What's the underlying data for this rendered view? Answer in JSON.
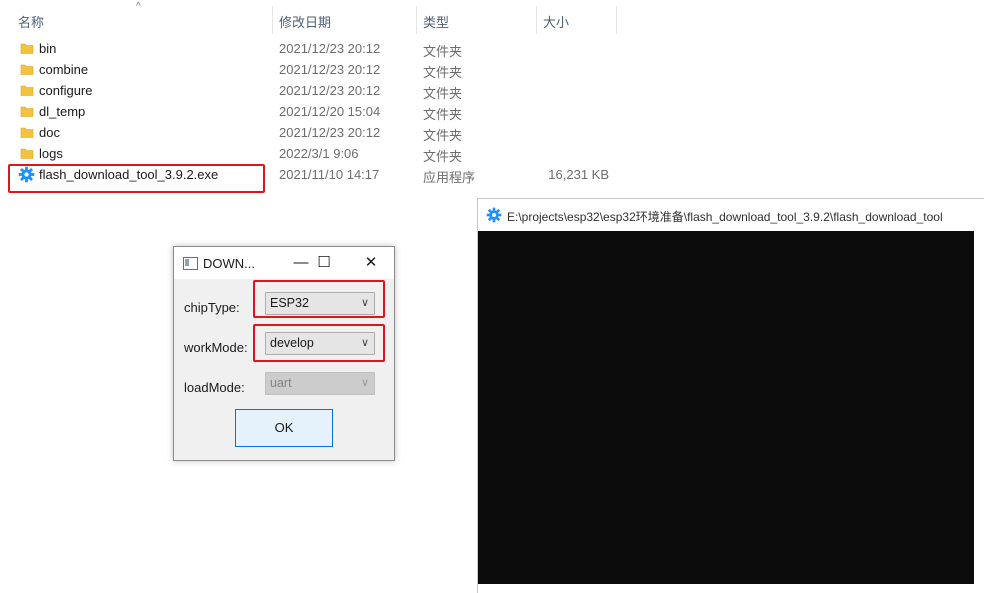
{
  "explorer": {
    "columns": {
      "name": "名称",
      "modified": "修改日期",
      "type": "类型",
      "size": "大小"
    },
    "files": [
      {
        "name": "bin",
        "modified": "2021/12/23 20:12",
        "type": "文件夹",
        "size": "",
        "icon": "folder-icon"
      },
      {
        "name": "combine",
        "modified": "2021/12/23 20:12",
        "type": "文件夹",
        "size": "",
        "icon": "folder-icon"
      },
      {
        "name": "configure",
        "modified": "2021/12/23 20:12",
        "type": "文件夹",
        "size": "",
        "icon": "folder-icon"
      },
      {
        "name": "dl_temp",
        "modified": "2021/12/20 15:04",
        "type": "文件夹",
        "size": "",
        "icon": "folder-icon"
      },
      {
        "name": "doc",
        "modified": "2021/12/23 20:12",
        "type": "文件夹",
        "size": "",
        "icon": "folder-icon"
      },
      {
        "name": "logs",
        "modified": "2022/3/1 9:06",
        "type": "文件夹",
        "size": "",
        "icon": "folder-icon"
      },
      {
        "name": "flash_download_tool_3.9.2.exe",
        "modified": "2021/11/10 14:17",
        "type": "应用程序",
        "size": "16,231 KB",
        "icon": "gear-icon"
      }
    ]
  },
  "console": {
    "title": "E:\\projects\\esp32\\esp32环境准备\\flash_download_tool_3.9.2\\flash_download_tool"
  },
  "dialog": {
    "title": "DOWN...",
    "minimize": "—",
    "maximize": "☐",
    "close": "✕",
    "chip_type_label": "chipType:",
    "chip_type_value": "ESP32",
    "work_mode_label": "workMode:",
    "work_mode_value": "develop",
    "load_mode_label": "loadMode:",
    "load_mode_value": "uart",
    "ok_label": "OK"
  },
  "colors": {
    "highlight": "#e0141c",
    "folder": "#f3c33f",
    "gear": "#1e90ff",
    "console_bg": "#0c0c0c"
  }
}
